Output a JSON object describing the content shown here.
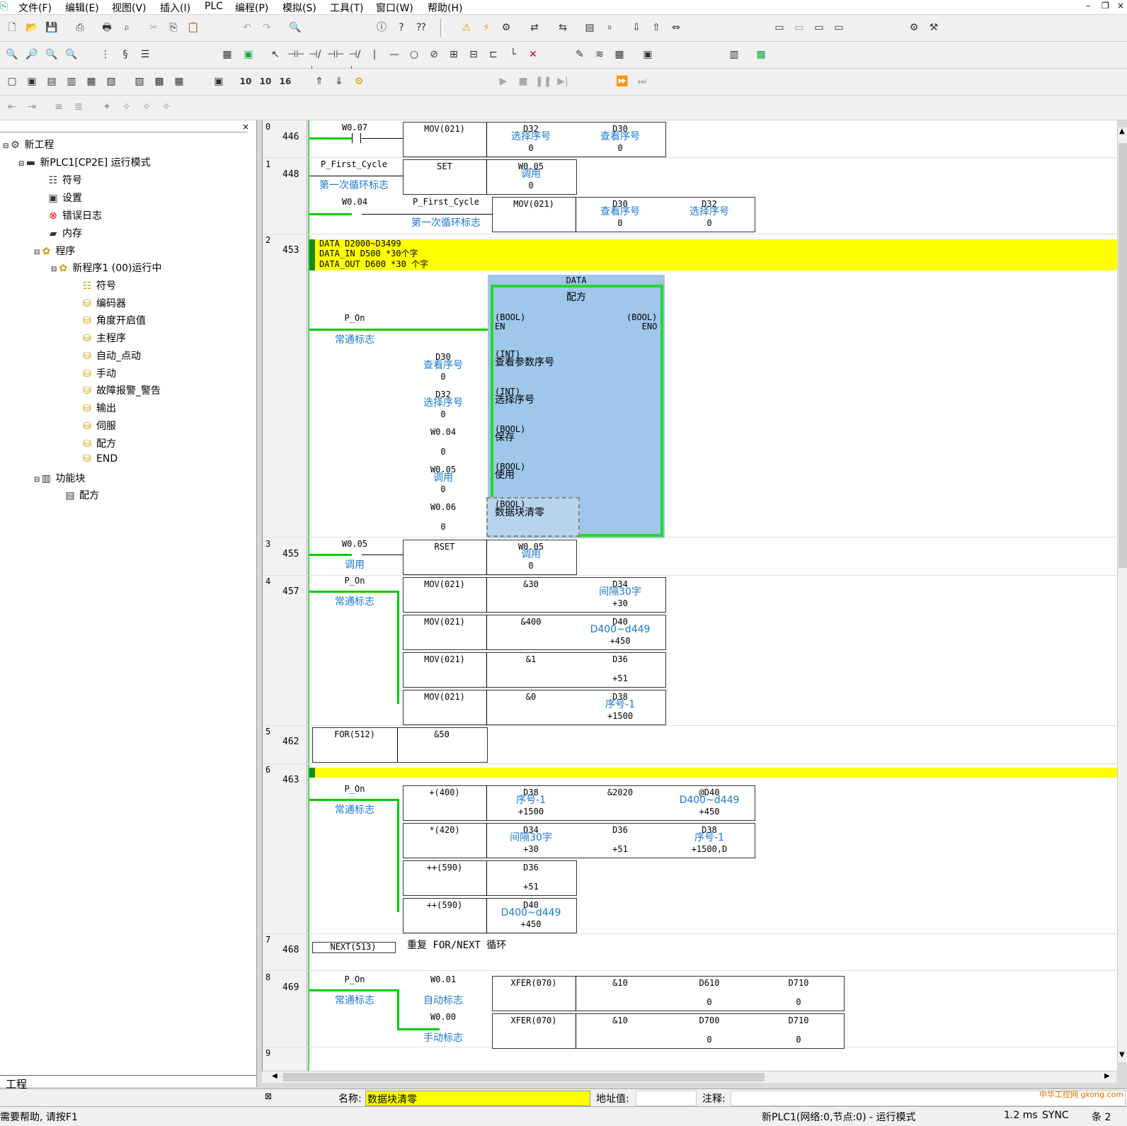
{
  "app": {
    "title_icon": "cx-programmer-icon"
  },
  "menu": [
    "文件(F)",
    "编辑(E)",
    "视图(V)",
    "插入(I)",
    "PLC",
    "编程(P)",
    "模拟(S)",
    "工具(T)",
    "窗口(W)",
    "帮助(H)"
  ],
  "toolbar_zoom_labels": [
    "10",
    "10",
    "16"
  ],
  "tree": {
    "project": "新工程",
    "plc": "新PLC1[CP2E] 运行模式",
    "plc_items": [
      "符号",
      "设置",
      "错误日志",
      "内存"
    ],
    "program": "程序",
    "program1": "新程序1 (00)运行中",
    "sections": [
      "符号",
      "编码器",
      "角度开启值",
      "主程序",
      "自动_点动",
      "手动",
      "故障报警_警告",
      "输出",
      "伺服",
      "配方",
      "END"
    ],
    "function_blocks": "功能块",
    "fb_items": [
      "配方"
    ],
    "tab": "工程"
  },
  "ladder": {
    "rungs": [
      {
        "num": "0",
        "addr": "446"
      },
      {
        "num": "1",
        "addr": "448"
      },
      {
        "num": "2",
        "addr": "453"
      },
      {
        "num": "3",
        "addr": "455"
      },
      {
        "num": "4",
        "addr": "457"
      },
      {
        "num": "5",
        "addr": "462"
      },
      {
        "num": "6",
        "addr": "463"
      },
      {
        "num": "7",
        "addr": "468"
      },
      {
        "num": "8",
        "addr": "469"
      },
      {
        "num": "9",
        "addr": ""
      }
    ],
    "r0": {
      "contact": "W0.07",
      "instr": "MOV(021)",
      "op1": "D32",
      "op1c": "选择序号",
      "op1v": "0",
      "op2": "D30",
      "op2c": "查看序号",
      "op2v": "0"
    },
    "r1": {
      "contact": "P_First_Cycle",
      "contact_cmt": "第一次循环标志",
      "instr": "SET",
      "op1": "W0.05",
      "op1c": "调用",
      "op1v": "0",
      "contact2": "W0.04",
      "contact3": "P_First_Cycle",
      "contact3_cmt": "第一次循环标志",
      "instr2": "MOV(021)",
      "op2": "D30",
      "op2c": "查看序号",
      "op2v": "0",
      "op3": "D32",
      "op3c": "选择序号",
      "op3v": "0"
    },
    "r2": {
      "comment": [
        "DATA D2000~D3499",
        "DATA_IN D500 *30个字",
        "DATA_OUT D600 *30 个字"
      ],
      "fb_title": "DATA",
      "fb_name": "配方",
      "contact": "P_On",
      "contact_cmt": "常通标志",
      "en": "(BOOL)\nEN",
      "eno": "(BOOL)\nENO",
      "inputs": [
        {
          "var": "D30",
          "cmt": "查看序号",
          "val": "0",
          "type": "(INT)",
          "pin": "查看参数序号"
        },
        {
          "var": "D32",
          "cmt": "选择序号",
          "val": "0",
          "type": "(INT)",
          "pin": "选择序号"
        },
        {
          "var": "W0.04",
          "cmt": "",
          "val": "0",
          "type": "(BOOL)",
          "pin": "保存"
        },
        {
          "var": "W0.05",
          "cmt": "调用",
          "val": "0",
          "type": "(BOOL)",
          "pin": "使用"
        },
        {
          "var": "W0.06",
          "cmt": "",
          "val": "0",
          "type": "(BOOL)",
          "pin": "数据块清零"
        }
      ]
    },
    "r3": {
      "contact": "W0.05",
      "contact_cmt": "调用",
      "instr": "RSET",
      "op1": "W0.05",
      "op1c": "调用",
      "op1v": "0"
    },
    "r4": {
      "contact": "P_On",
      "contact_cmt": "常通标志",
      "rows": [
        {
          "instr": "MOV(021)",
          "a": "&30",
          "b": "D34",
          "bc": "间隔30字",
          "bv": "+30"
        },
        {
          "instr": "MOV(021)",
          "a": "&400",
          "b": "D40",
          "bc": "D400~d449",
          "bv": "+450"
        },
        {
          "instr": "MOV(021)",
          "a": "&1",
          "b": "D36",
          "bc": "",
          "bv": "+51"
        },
        {
          "instr": "MOV(021)",
          "a": "&0",
          "b": "D38",
          "bc": "序号-1",
          "bv": "+1500"
        }
      ]
    },
    "r5": {
      "instr": "FOR(512)",
      "op": "&50"
    },
    "r6": {
      "contact": "P_On",
      "contact_cmt": "常通标志",
      "rows": [
        {
          "instr": "+(400)",
          "a": "D38",
          "ac": "序号-1",
          "av": "+1500",
          "b": "&2020",
          "c": "@D40",
          "cc": "D400~d449",
          "cv": "+450"
        },
        {
          "instr": "*(420)",
          "a": "D34",
          "ac": "间隔30字",
          "av": "+30",
          "b": "D36",
          "bv": "+51",
          "c": "D38",
          "cc": "序号-1",
          "cv": "+1500,D"
        },
        {
          "instr": "++(590)",
          "a": "D36",
          "ac": "",
          "av": "+51"
        },
        {
          "instr": "++(590)",
          "a": "D40",
          "ac": "D400~d449",
          "av": "+450"
        }
      ]
    },
    "r7": {
      "instr": "NEXT(513)",
      "comment": "重复 FOR/NEXT 循环"
    },
    "r8": {
      "contact": "P_On",
      "contact_cmt": "常通标志",
      "c2": "W0.01",
      "c2c": "自动标志",
      "c3": "W0.00",
      "c3c": "手动标志",
      "rows": [
        {
          "instr": "XFER(070)",
          "a": "&10",
          "b": "D610",
          "bv": "0",
          "c": "D710",
          "cv": "0"
        },
        {
          "instr": "XFER(070)",
          "a": "&10",
          "b": "D700",
          "bv": "0",
          "c": "D710",
          "cv": "0"
        }
      ]
    }
  },
  "props": {
    "name_label": "名称:",
    "name_value": "数据块清零",
    "addr_label": "地址值:",
    "note_label": "注释:"
  },
  "status": {
    "help": "需要帮助, 请按F1",
    "plc": "新PLC1(网络:0,节点:0) - 运行模式",
    "cycle": "1.2 ms",
    "sync": "SYNC",
    "extra": "条 2"
  },
  "watermark": "中华工控网 gkong.com",
  "colors": {
    "power": "#00cc00",
    "comment_text": "#1a78d0",
    "comment_bg": "#ffff00",
    "fb_bg": "#9ec7ea",
    "selection": "#ffff00"
  }
}
